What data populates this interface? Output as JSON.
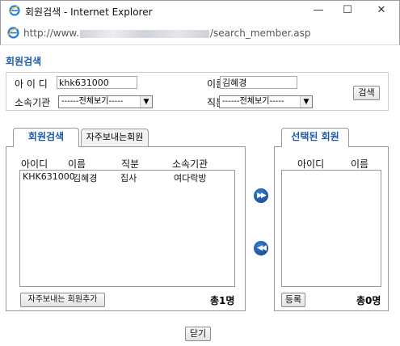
{
  "window": {
    "title": "회원검색 - Internet Explorer",
    "url_prefix": "http://www.",
    "url_suffix": "/search_member.asp",
    "minimize_glyph": "—",
    "maximize_glyph": "☐",
    "close_glyph": "✕"
  },
  "page_title": "회원검색",
  "search": {
    "id_label": "아 이 디",
    "id_value": "khk631000",
    "name_label": "이름",
    "name_value": "김혜경",
    "org_label": "소속기관",
    "org_selected": "------전체보기-----",
    "position_label": "직분",
    "position_selected": "------전체보기-----",
    "search_button": "검색"
  },
  "tabs": {
    "member_search": "회원검색",
    "frequent": "자주보내는회원",
    "selected": "선택된 회원"
  },
  "left_list": {
    "headers": [
      "아이디",
      "이름",
      "직분",
      "소속기관"
    ],
    "rows": [
      {
        "id": "KHK631000",
        "name": "김혜경",
        "position": "집사",
        "org": "여다락방"
      }
    ],
    "add_frequent_button": "자주보내는 회원추가",
    "total": "총1명"
  },
  "right_list": {
    "headers": [
      "아이디",
      "이름"
    ],
    "register_button": "등록",
    "total": "총0명"
  },
  "transfer": {
    "add_glyph": "▶▶",
    "remove_glyph": "◀◀"
  },
  "close_button": "닫기",
  "colors": {
    "accent": "#1e5aa0",
    "round_button": "#0e3f86"
  }
}
